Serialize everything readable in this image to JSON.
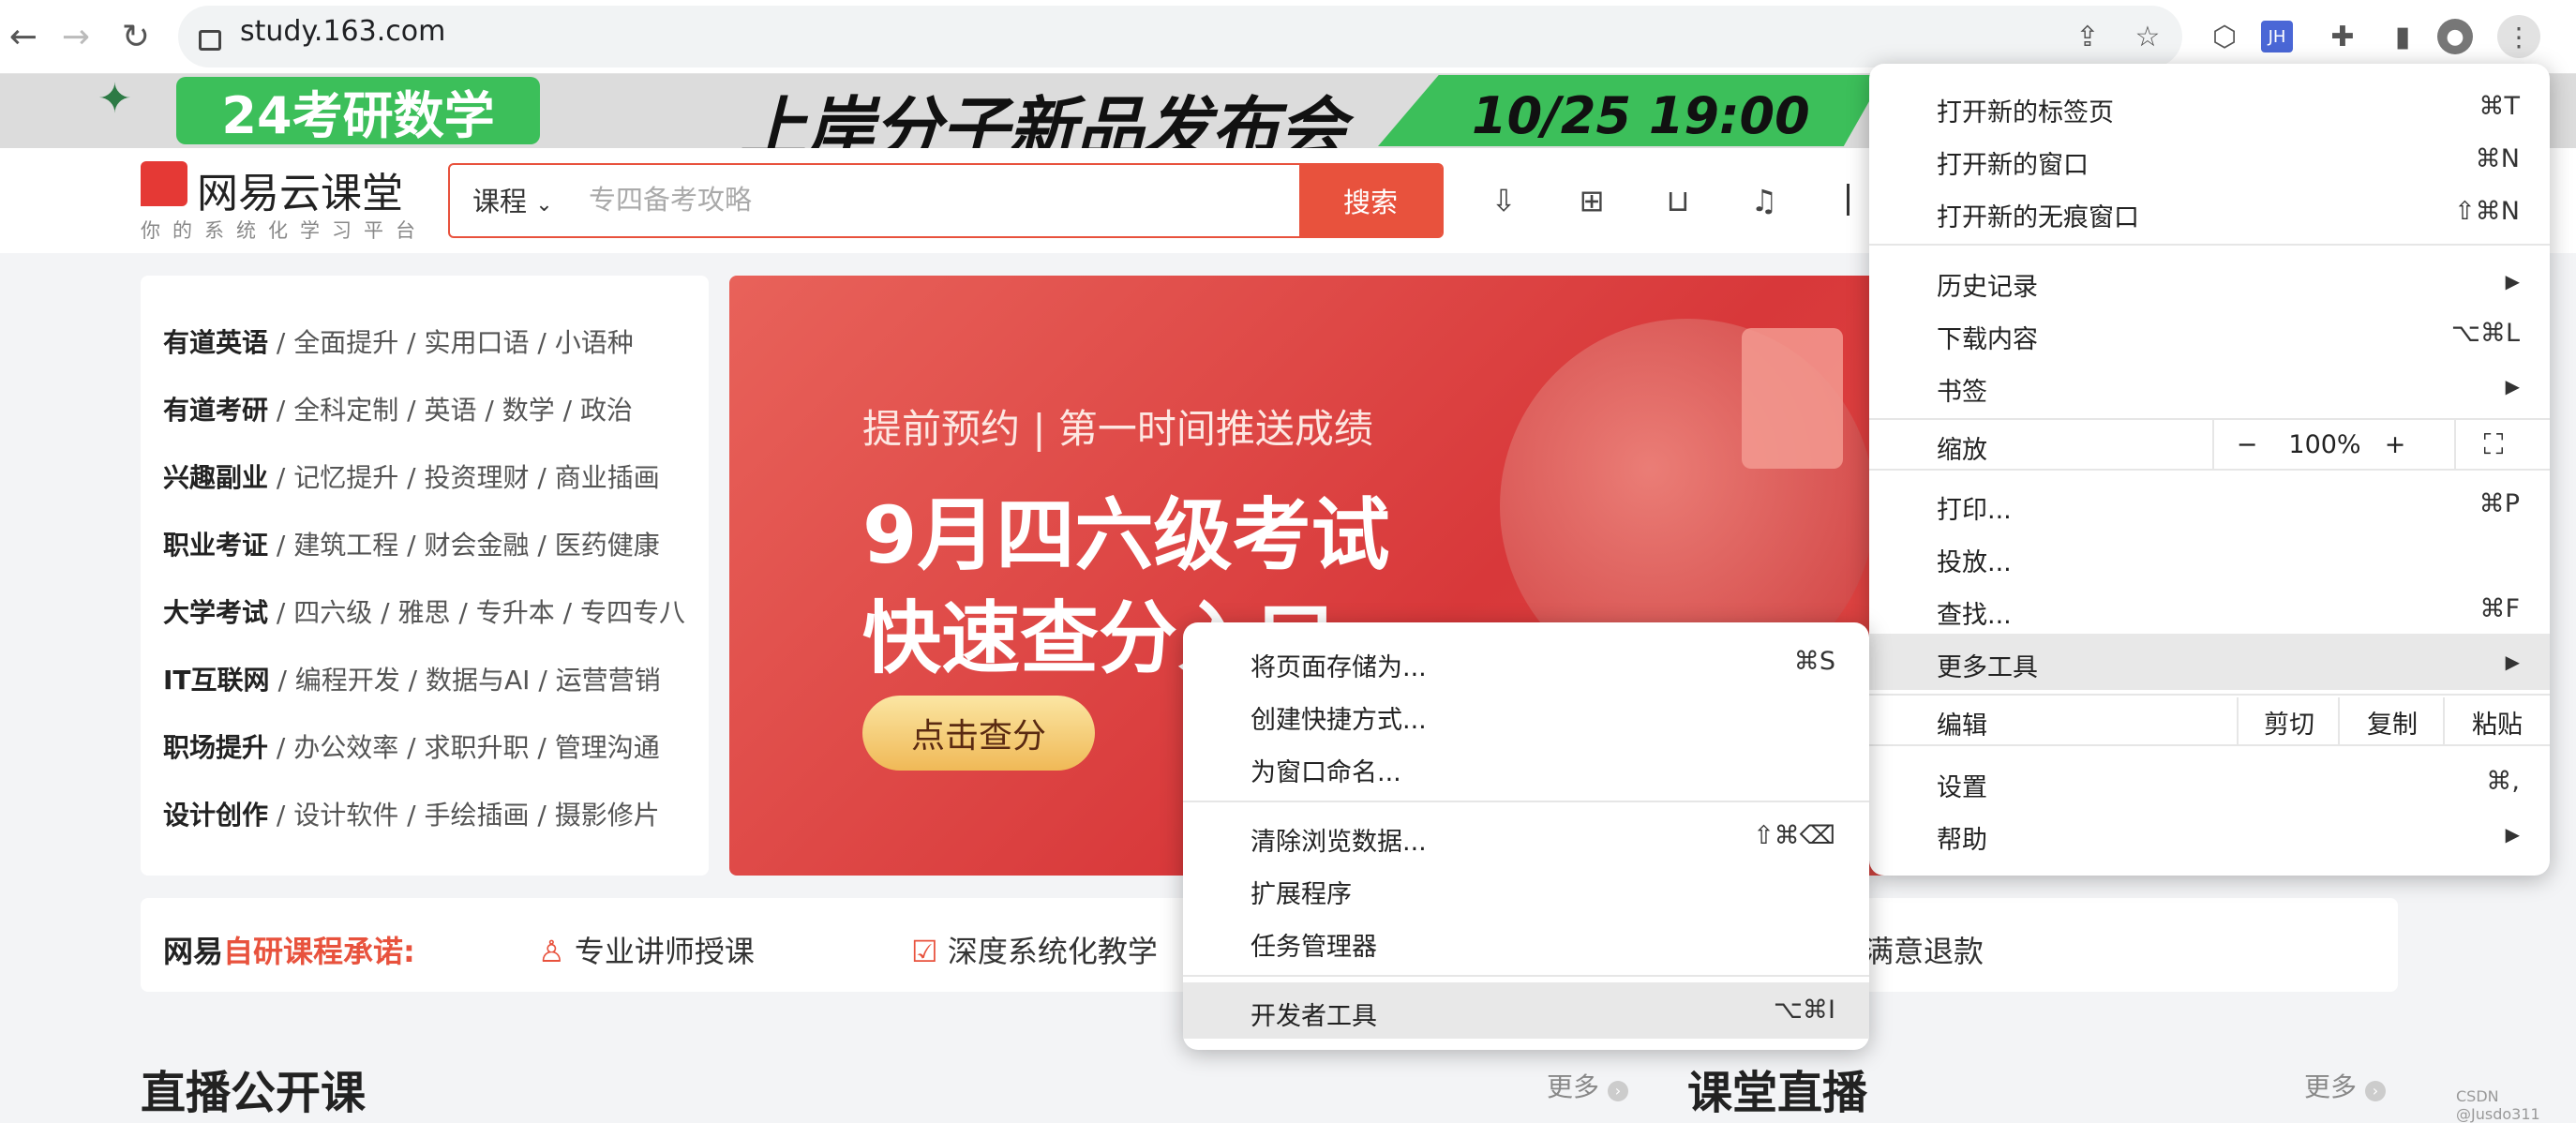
{
  "browser": {
    "url": "study.163.com",
    "ext_badge": "JH"
  },
  "promo": {
    "left_text": "24考研数学",
    "title": "上岸分子新品发布会",
    "date": "10/25 19:00"
  },
  "site": {
    "logo_name": "网易云课堂",
    "slogan": "你的系统化学习平台",
    "search": {
      "category": "课程",
      "placeholder": "专四备考攻略",
      "button": "搜索"
    }
  },
  "categories": [
    {
      "main": "有道英语",
      "subs": "/ 全面提升 / 实用口语 / 小语种"
    },
    {
      "main": "有道考研",
      "subs": "/ 全科定制 / 英语 / 数学 / 政治"
    },
    {
      "main": "兴趣副业",
      "subs": "/ 记忆提升 / 投资理财 / 商业插画"
    },
    {
      "main": "职业考证",
      "subs": "/ 建筑工程 / 财会金融 / 医药健康"
    },
    {
      "main": "大学考试",
      "subs": "/ 四六级 / 雅思 / 专升本 / 专四专八"
    },
    {
      "main": "IT互联网",
      "subs": "/ 编程开发 / 数据与AI / 运营营销"
    },
    {
      "main": "职场提升",
      "subs": "/ 办公效率 / 求职升职 / 管理沟通"
    },
    {
      "main": "设计创作",
      "subs": "/ 设计软件 / 手绘插画 / 摄影修片"
    }
  ],
  "hero": {
    "subtitle": "提前预约 | 第一时间推送成绩",
    "title_line1": "9月四六级考试",
    "title_line2": "快速查分入口",
    "button": "点击查分"
  },
  "promise": {
    "prefix": "网易",
    "highlight": "自研课程承诺:",
    "items": [
      "专业讲师授课",
      "深度系统化教学",
      "满意退款"
    ]
  },
  "sections": {
    "live_title": "直播公开课",
    "live_more": "更多",
    "class_title": "课堂直播",
    "class_more": "更多"
  },
  "chrome_menu": {
    "new_tab": {
      "label": "打开新的标签页",
      "shortcut": "⌘T"
    },
    "new_window": {
      "label": "打开新的窗口",
      "shortcut": "⌘N"
    },
    "incognito": {
      "label": "打开新的无痕窗口",
      "shortcut": "⇧⌘N"
    },
    "history": {
      "label": "历史记录"
    },
    "downloads": {
      "label": "下载内容",
      "shortcut": "⌥⌘L"
    },
    "bookmarks": {
      "label": "书签"
    },
    "zoom": {
      "label": "缩放",
      "minus": "−",
      "value": "100%",
      "plus": "+"
    },
    "print": {
      "label": "打印...",
      "shortcut": "⌘P"
    },
    "cast": {
      "label": "投放..."
    },
    "find": {
      "label": "查找...",
      "shortcut": "⌘F"
    },
    "more_tools": {
      "label": "更多工具"
    },
    "edit": {
      "label": "编辑",
      "cut": "剪切",
      "copy": "复制",
      "paste": "粘贴"
    },
    "settings": {
      "label": "设置",
      "shortcut": "⌘,"
    },
    "help": {
      "label": "帮助"
    }
  },
  "more_tools_menu": {
    "save_page": {
      "label": "将页面存储为...",
      "shortcut": "⌘S"
    },
    "create_shortcut": {
      "label": "创建快捷方式..."
    },
    "name_window": {
      "label": "为窗口命名..."
    },
    "clear_data": {
      "label": "清除浏览数据...",
      "shortcut": "⇧⌘⌫"
    },
    "extensions": {
      "label": "扩展程序"
    },
    "task_manager": {
      "label": "任务管理器"
    },
    "dev_tools": {
      "label": "开发者工具",
      "shortcut": "⌥⌘I"
    }
  },
  "watermark": "CSDN @Jusdo311"
}
